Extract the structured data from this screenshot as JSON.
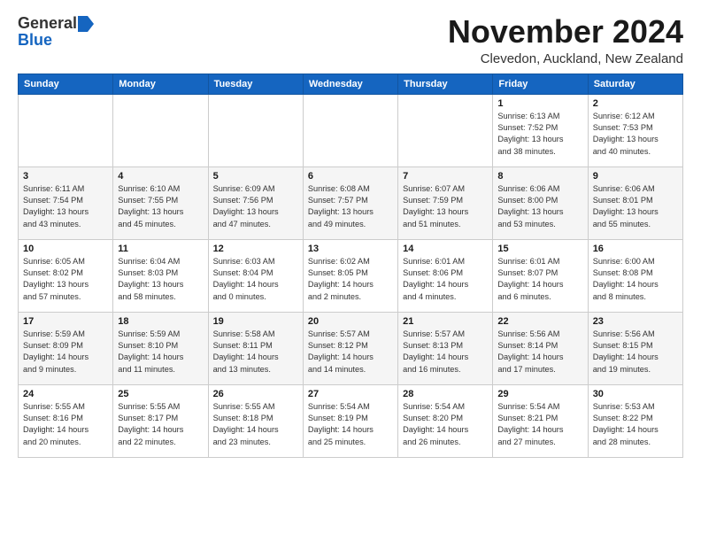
{
  "header": {
    "logo_general": "General",
    "logo_blue": "Blue",
    "title": "November 2024",
    "subtitle": "Clevedon, Auckland, New Zealand"
  },
  "days_of_week": [
    "Sunday",
    "Monday",
    "Tuesday",
    "Wednesday",
    "Thursday",
    "Friday",
    "Saturday"
  ],
  "weeks": [
    [
      {
        "day": "",
        "info": ""
      },
      {
        "day": "",
        "info": ""
      },
      {
        "day": "",
        "info": ""
      },
      {
        "day": "",
        "info": ""
      },
      {
        "day": "",
        "info": ""
      },
      {
        "day": "1",
        "info": "Sunrise: 6:13 AM\nSunset: 7:52 PM\nDaylight: 13 hours\nand 38 minutes."
      },
      {
        "day": "2",
        "info": "Sunrise: 6:12 AM\nSunset: 7:53 PM\nDaylight: 13 hours\nand 40 minutes."
      }
    ],
    [
      {
        "day": "3",
        "info": "Sunrise: 6:11 AM\nSunset: 7:54 PM\nDaylight: 13 hours\nand 43 minutes."
      },
      {
        "day": "4",
        "info": "Sunrise: 6:10 AM\nSunset: 7:55 PM\nDaylight: 13 hours\nand 45 minutes."
      },
      {
        "day": "5",
        "info": "Sunrise: 6:09 AM\nSunset: 7:56 PM\nDaylight: 13 hours\nand 47 minutes."
      },
      {
        "day": "6",
        "info": "Sunrise: 6:08 AM\nSunset: 7:57 PM\nDaylight: 13 hours\nand 49 minutes."
      },
      {
        "day": "7",
        "info": "Sunrise: 6:07 AM\nSunset: 7:59 PM\nDaylight: 13 hours\nand 51 minutes."
      },
      {
        "day": "8",
        "info": "Sunrise: 6:06 AM\nSunset: 8:00 PM\nDaylight: 13 hours\nand 53 minutes."
      },
      {
        "day": "9",
        "info": "Sunrise: 6:06 AM\nSunset: 8:01 PM\nDaylight: 13 hours\nand 55 minutes."
      }
    ],
    [
      {
        "day": "10",
        "info": "Sunrise: 6:05 AM\nSunset: 8:02 PM\nDaylight: 13 hours\nand 57 minutes."
      },
      {
        "day": "11",
        "info": "Sunrise: 6:04 AM\nSunset: 8:03 PM\nDaylight: 13 hours\nand 58 minutes."
      },
      {
        "day": "12",
        "info": "Sunrise: 6:03 AM\nSunset: 8:04 PM\nDaylight: 14 hours\nand 0 minutes."
      },
      {
        "day": "13",
        "info": "Sunrise: 6:02 AM\nSunset: 8:05 PM\nDaylight: 14 hours\nand 2 minutes."
      },
      {
        "day": "14",
        "info": "Sunrise: 6:01 AM\nSunset: 8:06 PM\nDaylight: 14 hours\nand 4 minutes."
      },
      {
        "day": "15",
        "info": "Sunrise: 6:01 AM\nSunset: 8:07 PM\nDaylight: 14 hours\nand 6 minutes."
      },
      {
        "day": "16",
        "info": "Sunrise: 6:00 AM\nSunset: 8:08 PM\nDaylight: 14 hours\nand 8 minutes."
      }
    ],
    [
      {
        "day": "17",
        "info": "Sunrise: 5:59 AM\nSunset: 8:09 PM\nDaylight: 14 hours\nand 9 minutes."
      },
      {
        "day": "18",
        "info": "Sunrise: 5:59 AM\nSunset: 8:10 PM\nDaylight: 14 hours\nand 11 minutes."
      },
      {
        "day": "19",
        "info": "Sunrise: 5:58 AM\nSunset: 8:11 PM\nDaylight: 14 hours\nand 13 minutes."
      },
      {
        "day": "20",
        "info": "Sunrise: 5:57 AM\nSunset: 8:12 PM\nDaylight: 14 hours\nand 14 minutes."
      },
      {
        "day": "21",
        "info": "Sunrise: 5:57 AM\nSunset: 8:13 PM\nDaylight: 14 hours\nand 16 minutes."
      },
      {
        "day": "22",
        "info": "Sunrise: 5:56 AM\nSunset: 8:14 PM\nDaylight: 14 hours\nand 17 minutes."
      },
      {
        "day": "23",
        "info": "Sunrise: 5:56 AM\nSunset: 8:15 PM\nDaylight: 14 hours\nand 19 minutes."
      }
    ],
    [
      {
        "day": "24",
        "info": "Sunrise: 5:55 AM\nSunset: 8:16 PM\nDaylight: 14 hours\nand 20 minutes."
      },
      {
        "day": "25",
        "info": "Sunrise: 5:55 AM\nSunset: 8:17 PM\nDaylight: 14 hours\nand 22 minutes."
      },
      {
        "day": "26",
        "info": "Sunrise: 5:55 AM\nSunset: 8:18 PM\nDaylight: 14 hours\nand 23 minutes."
      },
      {
        "day": "27",
        "info": "Sunrise: 5:54 AM\nSunset: 8:19 PM\nDaylight: 14 hours\nand 25 minutes."
      },
      {
        "day": "28",
        "info": "Sunrise: 5:54 AM\nSunset: 8:20 PM\nDaylight: 14 hours\nand 26 minutes."
      },
      {
        "day": "29",
        "info": "Sunrise: 5:54 AM\nSunset: 8:21 PM\nDaylight: 14 hours\nand 27 minutes."
      },
      {
        "day": "30",
        "info": "Sunrise: 5:53 AM\nSunset: 8:22 PM\nDaylight: 14 hours\nand 28 minutes."
      }
    ]
  ]
}
